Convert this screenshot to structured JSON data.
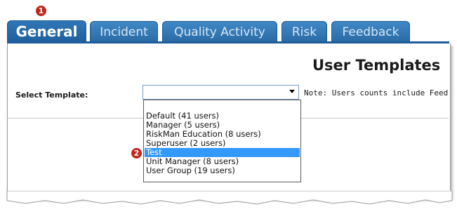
{
  "tabs": [
    {
      "label": "General",
      "active": true
    },
    {
      "label": "Incident",
      "active": false
    },
    {
      "label": "Quality Activity",
      "active": false
    },
    {
      "label": "Risk",
      "active": false
    },
    {
      "label": "Feedback",
      "active": false
    }
  ],
  "markers": {
    "one": "1",
    "two": "2"
  },
  "page": {
    "title": "User Templates"
  },
  "form": {
    "select_label": "Select Template:",
    "selected_value": "",
    "note": "Note: Users counts include Feed"
  },
  "dropdown": {
    "options": [
      "",
      "Default (41 users)",
      "Manager (5 users)",
      "RiskMan Education (8 users)",
      "Superuser (2 users)",
      "Test",
      "Unit Manager (8 users)",
      "User Group (19 users)"
    ],
    "highlighted": "Test"
  },
  "colors": {
    "tab": "#2b6aa5",
    "highlight": "#3399ff",
    "badge": "#c0261d"
  }
}
